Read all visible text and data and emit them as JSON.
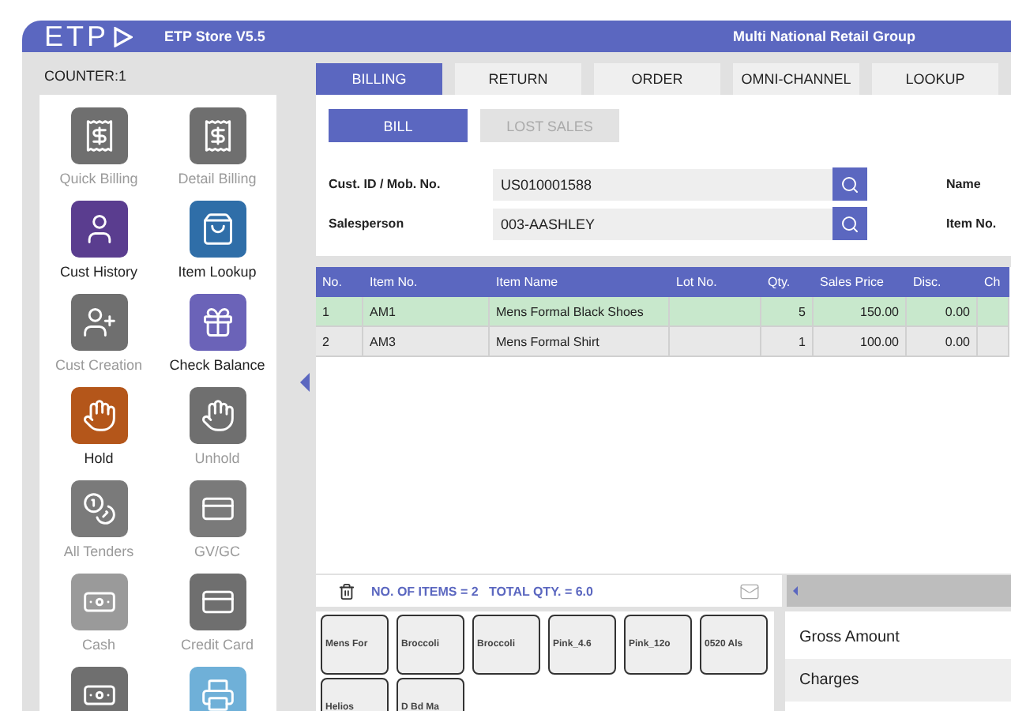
{
  "header": {
    "logo": "ETP",
    "store": "ETP Store V5.5",
    "company": "Multi National Retail Group"
  },
  "counter": "COUNTER:1",
  "actions": [
    {
      "label": "Quick Billing",
      "kind": "receipt",
      "enabled": false,
      "color": "#6f6f6f"
    },
    {
      "label": "Detail Billing",
      "kind": "receipt",
      "enabled": false,
      "color": "#6f6f6f"
    },
    {
      "label": "Cust History",
      "kind": "person",
      "enabled": true,
      "color": "#5a3d8f"
    },
    {
      "label": "Item Lookup",
      "kind": "bag",
      "enabled": true,
      "color": "#2f6ea8"
    },
    {
      "label": "Cust Creation",
      "kind": "person-add",
      "enabled": false,
      "color": "#6f6f6f"
    },
    {
      "label": "Check Balance",
      "kind": "gift",
      "enabled": true,
      "color": "#6b63b8"
    },
    {
      "label": "Hold",
      "kind": "hand",
      "enabled": true,
      "color": "#b4561a"
    },
    {
      "label": "Unhold",
      "kind": "hand",
      "enabled": false,
      "color": "#6f6f6f"
    },
    {
      "label": "All Tenders",
      "kind": "coins",
      "enabled": false,
      "color": "#7a7a7a"
    },
    {
      "label": "GV/GC",
      "kind": "card",
      "enabled": false,
      "color": "#7a7a7a"
    },
    {
      "label": "Cash",
      "kind": "cash",
      "enabled": false,
      "color": "#9a9a9a"
    },
    {
      "label": "Credit Card",
      "kind": "card",
      "enabled": false,
      "color": "#6f6f6f"
    },
    {
      "kind": "cash",
      "color": "#6f6f6f"
    },
    {
      "kind": "printer",
      "color": "#6fb0d8"
    }
  ],
  "tabs": [
    {
      "label": "BILLING",
      "selected": true
    },
    {
      "label": "RETURN",
      "selected": false
    },
    {
      "label": "ORDER",
      "selected": false
    },
    {
      "label": "OMNI-CHANNEL",
      "selected": false
    },
    {
      "label": "LOOKUP",
      "selected": false
    }
  ],
  "subtabs": [
    {
      "label": "BILL",
      "selected": true
    },
    {
      "label": "LOST SALES",
      "selected": false
    }
  ],
  "form": [
    {
      "label": "Cust. ID / Mob. No.",
      "value": "US010001588",
      "side_label": "Name"
    },
    {
      "label": "Salesperson",
      "value": "003-AASHLEY",
      "side_label": "Item No."
    }
  ],
  "table": {
    "columns": [
      "No.",
      "Item No.",
      "Item Name",
      "Lot No.",
      "Qty.",
      "Sales Price",
      "Disc.",
      "Ch"
    ],
    "rows": [
      {
        "selected": true,
        "cells": [
          "1",
          "AM1",
          "Mens Formal Black Shoes",
          "",
          "5",
          "150.00",
          "0.00",
          ""
        ]
      },
      {
        "selected": false,
        "cells": [
          "2",
          "AM3",
          "Mens Formal Shirt",
          "",
          "1",
          "100.00",
          "0.00",
          ""
        ]
      }
    ]
  },
  "status": "NO. OF ITEMS = 2   TOTAL QTY. = 6.0",
  "quick_items": [
    "Mens For",
    "Broccoli",
    "Broccoli",
    "Pink_4.6",
    "Pink_12o",
    "0520 Als",
    "Helios",
    "D Bd Ma"
  ],
  "summary": [
    {
      "label": "Gross Amount",
      "shaded": false
    },
    {
      "label": "Charges",
      "shaded": true
    }
  ]
}
